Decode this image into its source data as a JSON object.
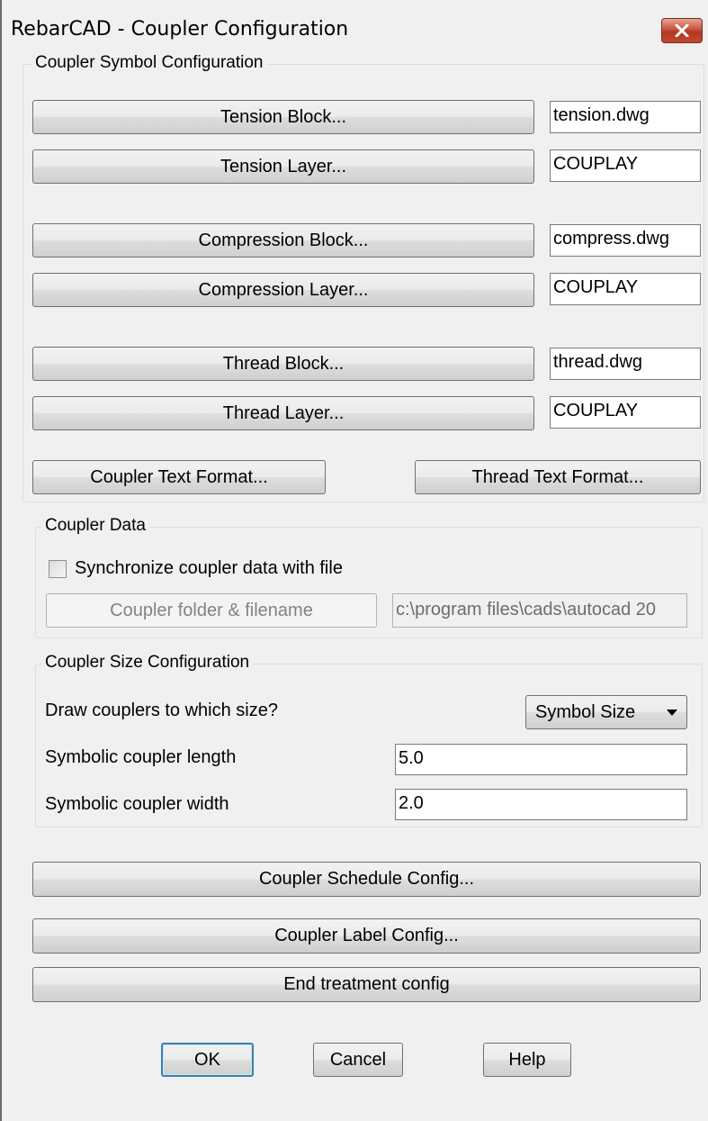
{
  "window": {
    "title": "RebarCAD - Coupler Configuration",
    "close_icon": "close-x-icon"
  },
  "symbol_config": {
    "legend": "Coupler Symbol Configuration",
    "tension_block_label": "Tension Block...",
    "tension_block_value": "tension.dwg",
    "tension_layer_label": "Tension Layer...",
    "tension_layer_value": "COUPLAY",
    "compression_block_label": "Compression Block...",
    "compression_block_value": "compress.dwg",
    "compression_layer_label": "Compression Layer...",
    "compression_layer_value": "COUPLAY",
    "thread_block_label": "Thread Block...",
    "thread_block_value": "thread.dwg",
    "thread_layer_label": "Thread Layer...",
    "thread_layer_value": "COUPLAY",
    "coupler_text_format_label": "Coupler Text Format...",
    "thread_text_format_label": "Thread Text Format..."
  },
  "coupler_data": {
    "legend": "Coupler Data",
    "sync_label": "Synchronize coupler data with file",
    "sync_checked": false,
    "folder_button_label": "Coupler folder & filename",
    "folder_path": "c:\\program files\\cads\\autocad 20"
  },
  "size_config": {
    "legend": "Coupler Size Configuration",
    "draw_size_label": "Draw couplers to which size?",
    "draw_size_value": "Symbol Size",
    "length_label": "Symbolic coupler length",
    "length_value": "5.0",
    "width_label": "Symbolic coupler width",
    "width_value": "2.0"
  },
  "extra_buttons": {
    "schedule_label": "Coupler Schedule Config...",
    "label_config_label": "Coupler Label Config...",
    "end_treatment_label": "End treatment config"
  },
  "footer": {
    "ok_label": "OK",
    "cancel_label": "Cancel",
    "help_label": "Help"
  }
}
